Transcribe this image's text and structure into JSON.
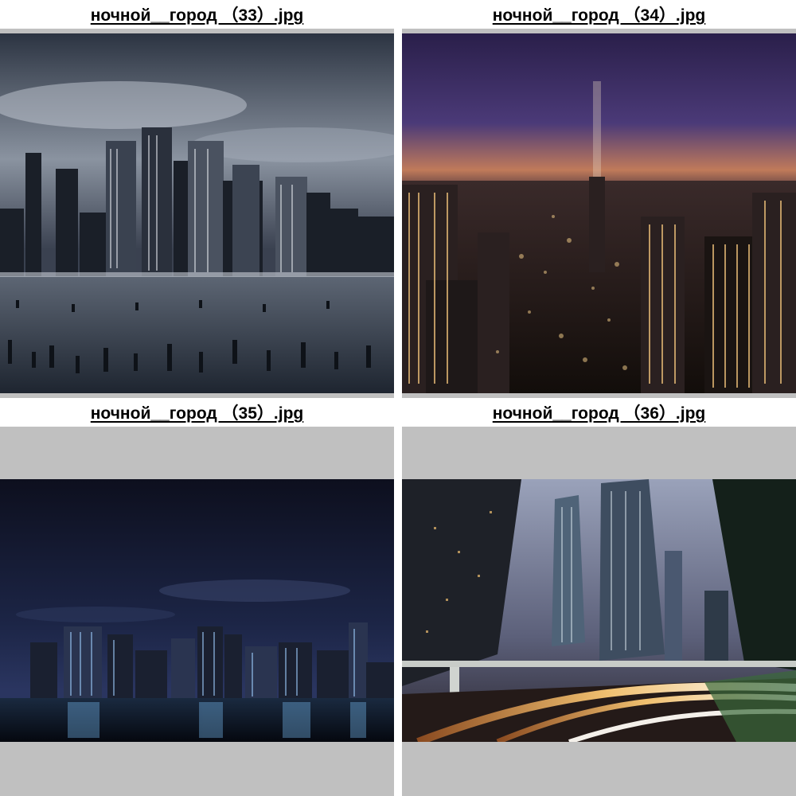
{
  "gallery": {
    "items": [
      {
        "caption": "ночной__город （33）.jpg",
        "thumbnail": "night-city-photo"
      },
      {
        "caption": "ночной__город （34）.jpg",
        "thumbnail": "night-city-photo"
      },
      {
        "caption": "ночной__город （35）.jpg",
        "thumbnail": "night-city-photo"
      },
      {
        "caption": "ночной__город （36）.jpg",
        "thumbnail": "night-city-photo"
      }
    ]
  },
  "colors": {
    "frame_background": "#c0c0c0",
    "page_background": "#ffffff",
    "caption_text": "#000000"
  }
}
